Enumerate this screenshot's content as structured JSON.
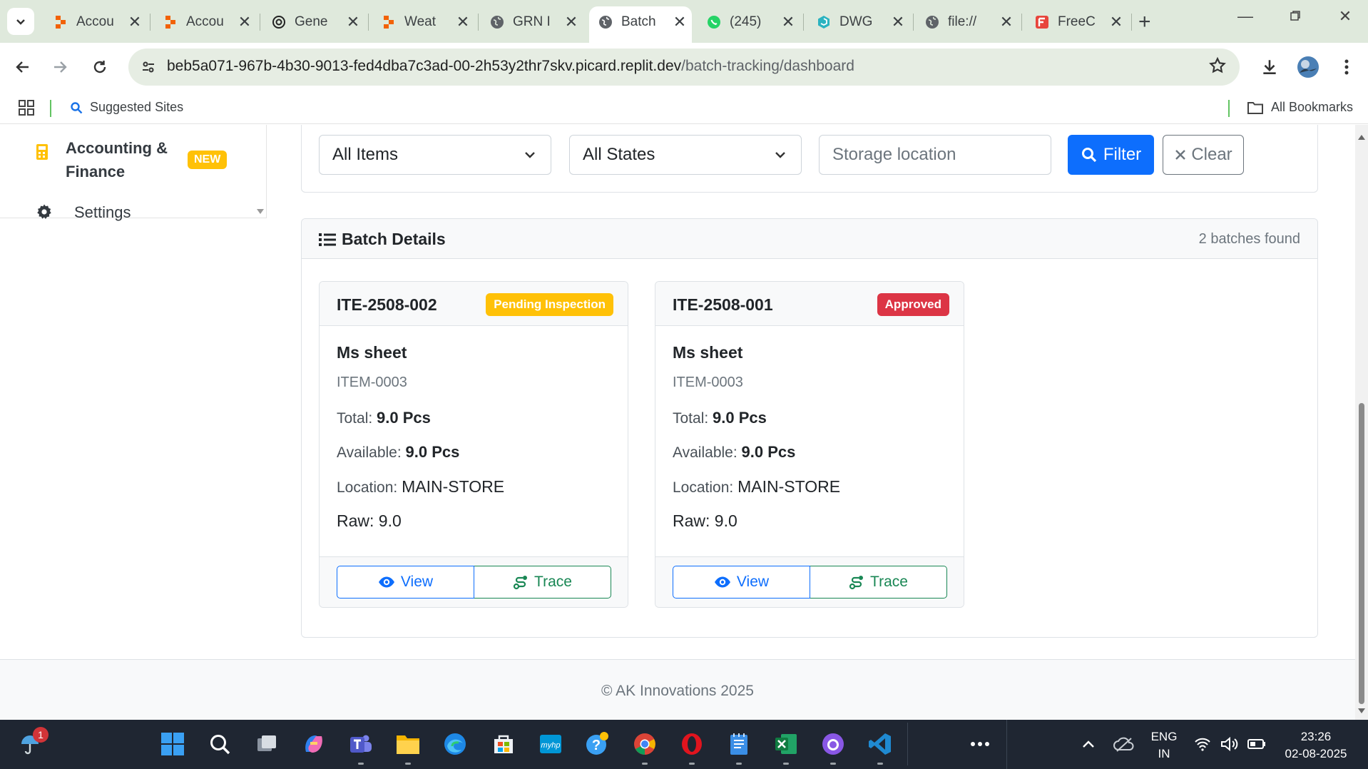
{
  "browser": {
    "tabs": [
      {
        "title": "Accou",
        "icon": "replit-icon"
      },
      {
        "title": "Accou",
        "icon": "replit-icon"
      },
      {
        "title": "Gene",
        "icon": "openai-icon"
      },
      {
        "title": "Weat",
        "icon": "replit-icon"
      },
      {
        "title": "GRN I",
        "icon": "globe-icon"
      },
      {
        "title": "Batch",
        "icon": "globe-icon",
        "active": true
      },
      {
        "title": "(245)",
        "icon": "whatsapp-icon"
      },
      {
        "title": "DWG",
        "icon": "dwg-icon"
      },
      {
        "title": "file://",
        "icon": "globe-icon"
      },
      {
        "title": "FreeC",
        "icon": "freecad-icon"
      }
    ],
    "url_host": "beb5a071-967b-4b30-9013-fed4dba7c3ad-00-2h53y2thr7skv.picard.replit.dev",
    "url_path": "/batch-tracking/dashboard",
    "bookmarks": {
      "suggested": "Suggested Sites",
      "all": "All Bookmarks"
    }
  },
  "sidebar": {
    "accounting_label_1": "Accounting &",
    "accounting_label_2": "Finance",
    "new_badge": "NEW",
    "settings_label": "Settings"
  },
  "filters": {
    "items_select": "All Items",
    "states_select": "All States",
    "location_placeholder": "Storage location",
    "filter_button": "Filter",
    "clear_button": "Clear"
  },
  "batch_details": {
    "title": "Batch Details",
    "count": "2 batches found",
    "batches": [
      {
        "id": "ITE-2508-002",
        "status": "Pending Inspection",
        "name": "Ms sheet",
        "code": "ITEM-0003",
        "total_label": "Total:",
        "total": "9.0 Pcs",
        "available_label": "Available:",
        "available": "9.0 Pcs",
        "location_label": "Location:",
        "location": "MAIN-STORE",
        "raw": "Raw: 9.0",
        "view": "View",
        "trace": "Trace"
      },
      {
        "id": "ITE-2508-001",
        "status": "Approved",
        "name": "Ms sheet",
        "code": "ITEM-0003",
        "total_label": "Total:",
        "total": "9.0 Pcs",
        "available_label": "Available:",
        "available": "9.0 Pcs",
        "location_label": "Location:",
        "location": "MAIN-STORE",
        "raw": "Raw: 9.0",
        "view": "View",
        "trace": "Trace"
      }
    ]
  },
  "footer": {
    "text": "© AK Innovations 2025"
  },
  "taskbar": {
    "notification_count": "1",
    "lang_1": "ENG",
    "lang_2": "IN",
    "time": "23:26",
    "date": "02-08-2025"
  },
  "colors": {
    "primary": "#0d6efd",
    "success": "#198754",
    "warning": "#ffc107",
    "danger": "#dc3545",
    "chrome_bg": "#dfe9dc"
  }
}
